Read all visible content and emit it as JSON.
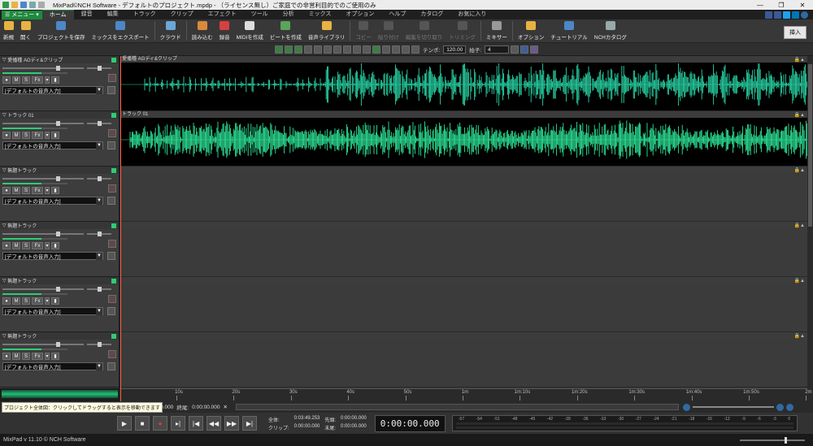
{
  "window": {
    "title": "MixPad©NCH Software - デフォルトのプロジェクト.mpdp - （ライセンス無し）ご家庭での非営利目的でのご使用のみ"
  },
  "menu": {
    "main_label": "メニュー",
    "tabs": [
      "ホーム",
      "録音",
      "編集",
      "トラック",
      "クリップ",
      "エフェクト",
      "ツール",
      "分析",
      "ミックス",
      "オプション",
      "ヘルプ",
      "カタログ",
      "お気に入り"
    ]
  },
  "ribbon": {
    "buttons": [
      {
        "label": "新規",
        "color": "#e8b341",
        "enabled": true
      },
      {
        "label": "開く",
        "color": "#e8b341",
        "enabled": true
      },
      {
        "label": "プロジェクトを保存",
        "color": "#4d86c9",
        "enabled": true
      },
      {
        "label": "ミックスをエクスポート",
        "color": "#4d86c9",
        "enabled": true
      },
      {
        "label": "クラウド",
        "color": "#6aa9d8",
        "enabled": true
      },
      {
        "label": "読み込む",
        "color": "#d98a3b",
        "enabled": true
      },
      {
        "label": "録音",
        "color": "#d84040",
        "enabled": true
      },
      {
        "label": "MIDIを作成",
        "color": "#dddddd",
        "enabled": true
      },
      {
        "label": "ビートを作成",
        "color": "#5aa55a",
        "enabled": true
      },
      {
        "label": "音声ライブラリ",
        "color": "#e8b341",
        "enabled": true
      },
      {
        "label": "コピー",
        "color": "#777",
        "enabled": false
      },
      {
        "label": "貼り付け",
        "color": "#777",
        "enabled": false
      },
      {
        "label": "編集を切り取り",
        "color": "#777",
        "enabled": false
      },
      {
        "label": "トリミング",
        "color": "#777",
        "enabled": false
      },
      {
        "label": "ミキサー",
        "color": "#999999",
        "enabled": true
      },
      {
        "label": "オプション",
        "color": "#e8b341",
        "enabled": true
      },
      {
        "label": "チュートリアル",
        "color": "#4d86c9",
        "enabled": true
      },
      {
        "label": "NCHカタログ",
        "color": "#9aa",
        "enabled": true
      }
    ],
    "insert_label": "挿入"
  },
  "toolbar": {
    "tempo_label": "テンポ:",
    "tempo_value": "120.00",
    "meter_label": "拍子:",
    "meter_value": "4"
  },
  "tracks": [
    {
      "name": "愛播種 AGディ&クリップ",
      "input": "[デフォルトの音声入力]",
      "has_audio": true,
      "clip_name": "愛播種 AGディ&クリップ"
    },
    {
      "name": "トラック 01",
      "input": "[デフォルトの音声入力]",
      "has_audio": true,
      "clip_name": "トラック 01"
    },
    {
      "name": "無題トラック",
      "input": "[デフォルトの音声入力]",
      "has_audio": false,
      "clip_name": ""
    },
    {
      "name": "無題トラック",
      "input": "[デフォルトの音声入力]",
      "has_audio": false,
      "clip_name": ""
    },
    {
      "name": "無題トラック",
      "input": "[デフォルトの音声入力]",
      "has_audio": false,
      "clip_name": ""
    },
    {
      "name": "無題トラック",
      "input": "[デフォルトの音声入力]",
      "has_audio": false,
      "clip_name": ""
    }
  ],
  "track_buttons": {
    "mute": "M",
    "solo": "S",
    "fx": "Fx"
  },
  "ruler": {
    "ticks": [
      "10s",
      "20s",
      "30s",
      "40s",
      "50s",
      "1m",
      "1m:10s",
      "1m:20s",
      "1m:30s",
      "1m:40s",
      "1m:50s",
      "2m"
    ]
  },
  "status": {
    "tooltip": "プロジェクト全体図：クリックしてドラッグすると表示を移動できます",
    "start_label": "0:00:00.000",
    "end_label": "終尾:",
    "end_value": "0:00:00.000"
  },
  "transport": {
    "total_label": "全体:",
    "total_value": "0:03:49.253",
    "clip_label": "クリップ:",
    "clip_value": "0:00:00.000",
    "head_label": "先頭:",
    "head_value": "0:00:00.000",
    "tail_label": "末尾:",
    "tail_value": "0:00:00.000",
    "current_time": "0:00:00.000"
  },
  "levels": {
    "labels": [
      "-57",
      "-54",
      "-51",
      "-48",
      "-45",
      "-42",
      "-39",
      "-36",
      "-33",
      "-30",
      "-27",
      "-24",
      "-21",
      "-18",
      "-15",
      "-12",
      "-9",
      "-6",
      "-3",
      "0"
    ]
  },
  "statusbar": {
    "version": "MixPad v 11.10 © NCH Software"
  },
  "colors": {
    "wave1": "#29d6a7",
    "wave2": "#2ee89a",
    "accent": "#1e8a3c"
  }
}
